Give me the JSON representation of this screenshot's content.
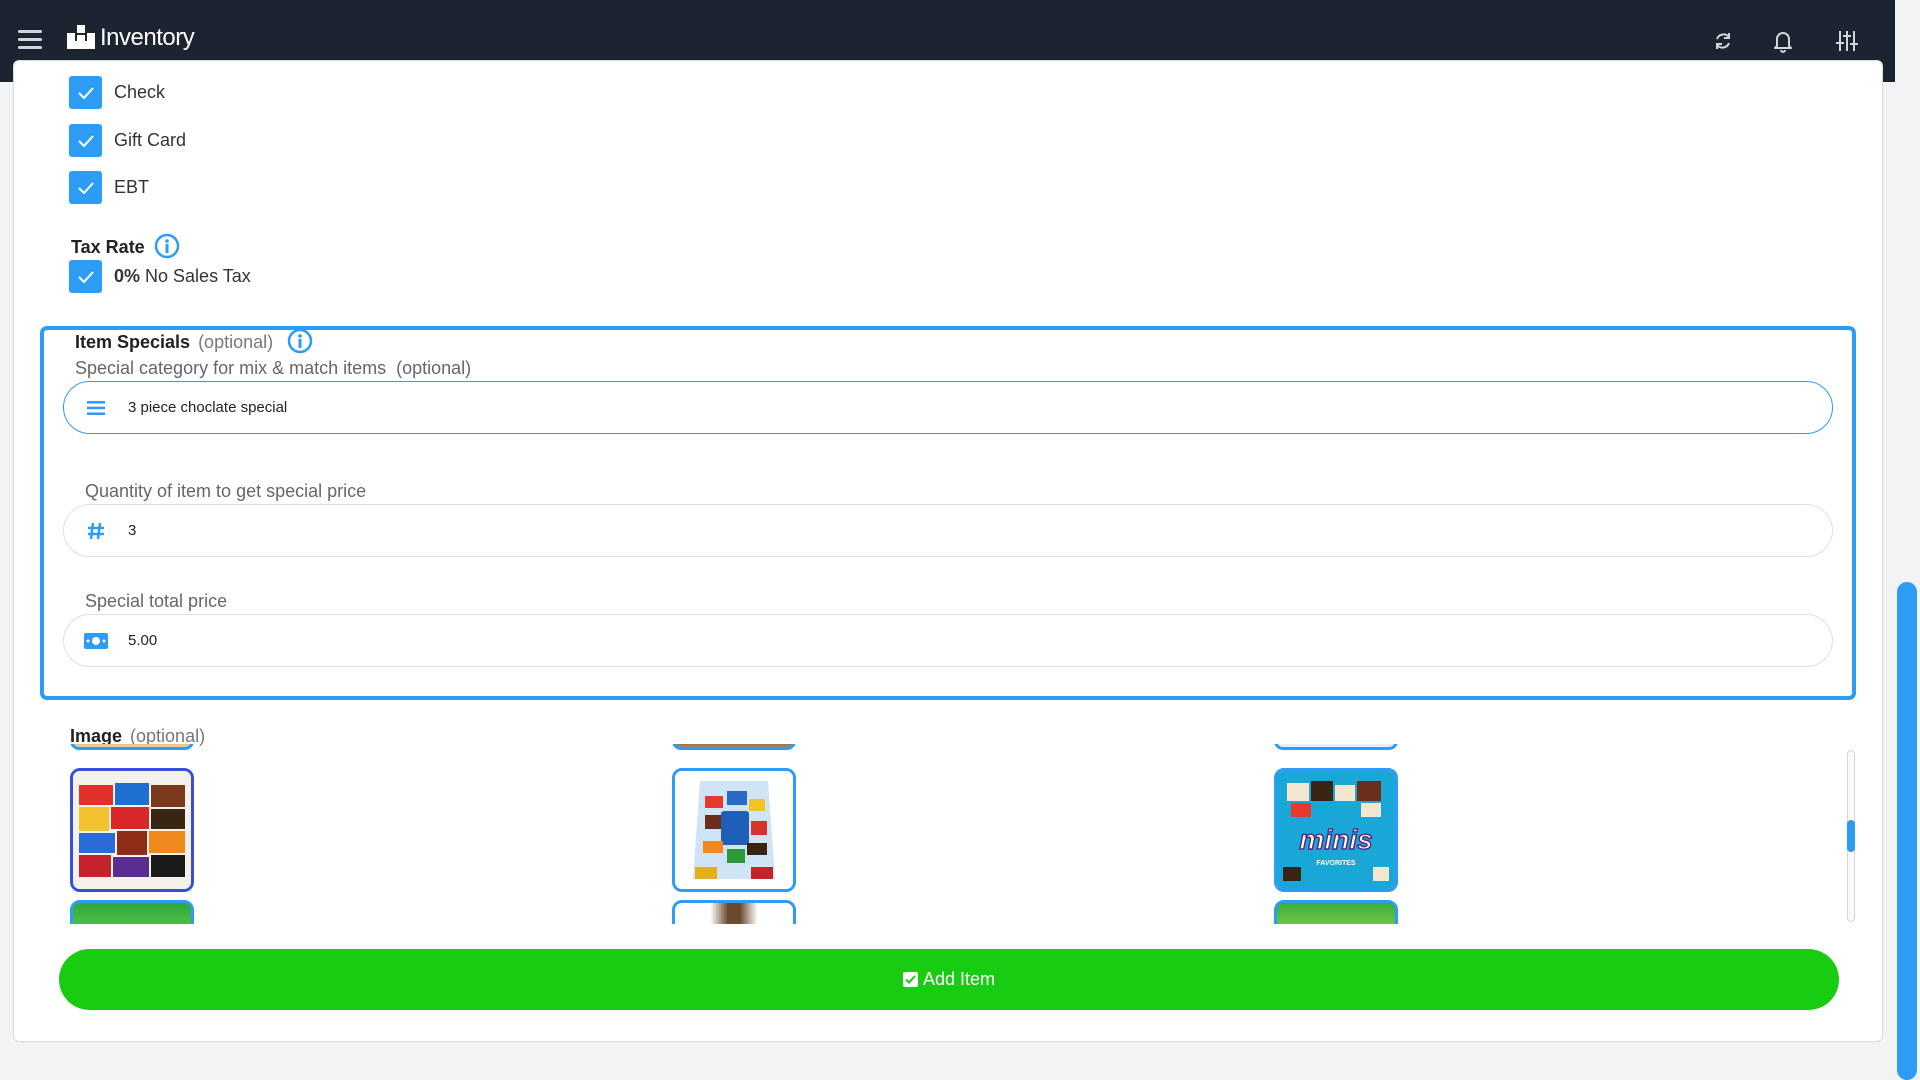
{
  "header": {
    "title": "Inventory",
    "menu_icon": "hamburger-menu-icon",
    "logo_icon": "boxes-logo-icon",
    "actions": [
      "sync-icon",
      "bell-icon",
      "sliders-icon"
    ]
  },
  "payment_methods": [
    {
      "label": "Check",
      "checked": true
    },
    {
      "label": "Gift Card",
      "checked": true
    },
    {
      "label": "EBT",
      "checked": true
    }
  ],
  "tax": {
    "heading": "Tax Rate",
    "rate": "0%",
    "label": "No Sales Tax",
    "checked": true
  },
  "specials": {
    "heading": "Item Specials",
    "optional": "(optional)",
    "category_label": "Special category for mix & match items",
    "category_optional": "(optional)",
    "category_value": "3 piece choclate special",
    "quantity_label": "Quantity of item to get special price",
    "quantity_value": "3",
    "price_label": "Special total price",
    "price_value": "5.00"
  },
  "image_section": {
    "heading": "Image",
    "optional": "(optional)",
    "thumbnails": [
      {
        "name": "candy-variety-pack",
        "selected": true
      },
      {
        "name": "chocolate-mix-bag",
        "selected": false
      },
      {
        "name": "minis-favorites-bag",
        "selected": false,
        "caption": "minis",
        "subcaption": "FAVORITES"
      }
    ]
  },
  "add_button": {
    "label": "Add Item"
  },
  "colors": {
    "accent": "#2c9cf5",
    "header_bg": "#1c2431",
    "success": "#18cc12"
  }
}
